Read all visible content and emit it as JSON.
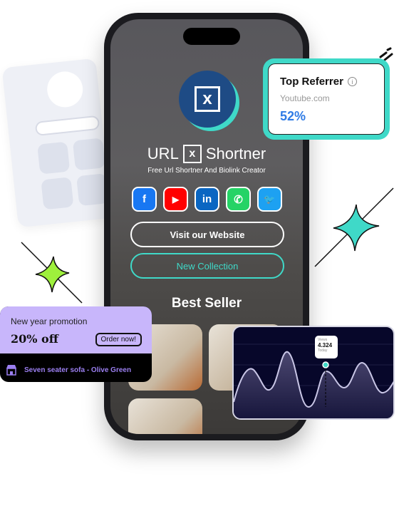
{
  "phone": {
    "brand": {
      "title_left": "URL",
      "title_right": "Shortner",
      "logo_glyph": "x",
      "subtitle": "Free Url Shortner And Biolink Creator"
    },
    "socials": [
      {
        "icon": "facebook-icon",
        "glyph": "f",
        "color": "#1877f2"
      },
      {
        "icon": "youtube-icon",
        "glyph": "▶",
        "color": "#ff0000"
      },
      {
        "icon": "linkedin-icon",
        "glyph": "in",
        "color": "#0a66c2"
      },
      {
        "icon": "whatsapp-icon",
        "glyph": "✆",
        "color": "#25d366"
      },
      {
        "icon": "twitter-icon",
        "glyph": "🐦",
        "color": "#1da1f2"
      }
    ],
    "buttons": {
      "visit": "Visit our Website",
      "collection": "New Collection"
    },
    "section_title": "Best Seller"
  },
  "top_referrer": {
    "title": "Top Referrer",
    "info": "i",
    "source": "Youtube.com",
    "percent": "52%"
  },
  "promo": {
    "title": "New year promotion",
    "discount": "20% off",
    "cta": "Order now!",
    "product": "Seven seater sofa - Olive Green"
  },
  "views_chart": {
    "tooltip_label": "Views",
    "tooltip_value": "4.324",
    "tooltip_period": "Today"
  },
  "colors": {
    "accent": "#3fd9c8",
    "brand": "#1e4b85",
    "promo": "#c8b6fb",
    "link": "#2f7be5",
    "chart_bg": "#07072a"
  }
}
